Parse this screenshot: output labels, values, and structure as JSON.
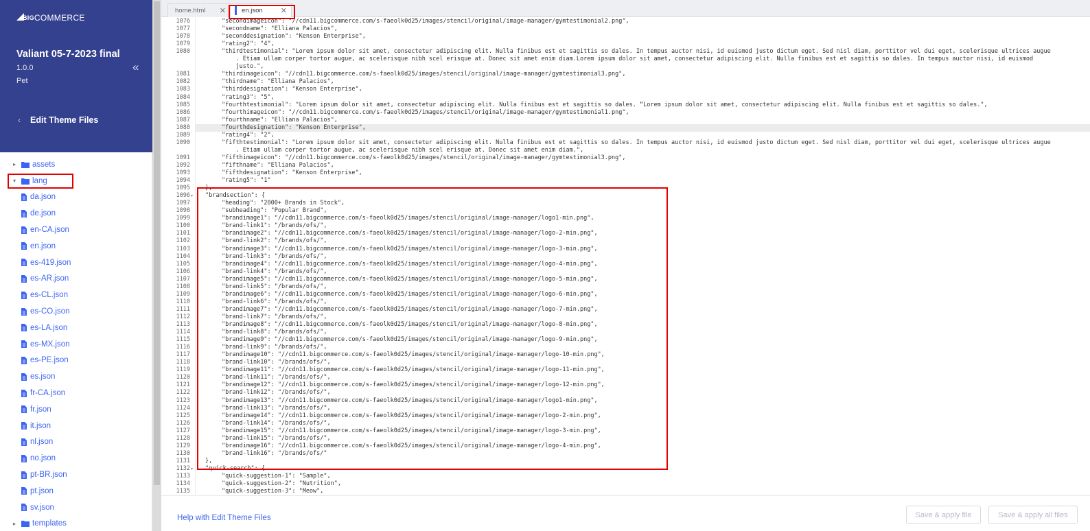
{
  "brand": {
    "logo_text": "COMMERCE",
    "logo_mark": "BIG"
  },
  "theme": {
    "name": "Valiant 05-7-2023 final",
    "version": "1.0.0",
    "category": "Pet"
  },
  "nav": {
    "back_label": "Edit Theme Files",
    "collapse_icon": "double-chevron-left-icon"
  },
  "tree": {
    "folders": [
      {
        "label": "assets",
        "expanded": false
      },
      {
        "label": "lang",
        "expanded": true
      },
      {
        "label": "templates",
        "expanded": false
      }
    ],
    "lang_files": [
      "da.json",
      "de.json",
      "en-CA.json",
      "en.json",
      "es-419.json",
      "es-AR.json",
      "es-CL.json",
      "es-CO.json",
      "es-LA.json",
      "es-MX.json",
      "es-PE.json",
      "es.json",
      "fr-CA.json",
      "fr.json",
      "it.json",
      "nl.json",
      "no.json",
      "pt-BR.json",
      "pt.json",
      "sv.json"
    ]
  },
  "tabs": [
    {
      "label": "home.html",
      "active": false
    },
    {
      "label": "en.json",
      "active": true
    }
  ],
  "editor": {
    "highlighted_line": 1088,
    "lines": [
      {
        "n": 1076,
        "t": "\"secondimageicon\": \"//cdn11.bigcommerce.com/s-faeolk0d25/images/stencil/original/image-manager/gymtestimonial2.png\",",
        "i": 2
      },
      {
        "n": 1077,
        "t": "\"secondname\": \"Elliana Palacios\",",
        "i": 2
      },
      {
        "n": 1078,
        "t": "\"seconddesignation\": \"Kenson Enterprise\",",
        "i": 2
      },
      {
        "n": 1079,
        "t": "\"rating2\": \"4\",",
        "i": 2
      },
      {
        "n": 1080,
        "t": "\"thirdtestimonial\": \"Lorem ipsum dolor sit amet, consectetur adipiscing elit. Nulla finibus est et sagittis so dales. In tempus auctor nisi, id euismod justo dictum eget. Sed nisl diam, porttitor vel dui eget, scelerisque ultrices augue",
        "i": 2
      },
      {
        "n": null,
        "t": "    . Etiam ullam corper tortor augue, ac scelerisque nibh scel erisque at. Donec sit amet enim diam.Lorem ipsum dolor sit amet, consectetur adipiscing elit. Nulla finibus est et sagittis so dales. In tempus auctor nisi, id euismod",
        "i": 2
      },
      {
        "n": null,
        "t": "    justo.\",",
        "i": 2
      },
      {
        "n": 1081,
        "t": "\"thirdimageicon\": \"//cdn11.bigcommerce.com/s-faeolk0d25/images/stencil/original/image-manager/gymtestimonial3.png\",",
        "i": 2
      },
      {
        "n": 1082,
        "t": "\"thirdname\": \"Elliana Palacios\",",
        "i": 2
      },
      {
        "n": 1083,
        "t": "\"thirddesignation\": \"Kenson Enterprise\",",
        "i": 2
      },
      {
        "n": 1084,
        "t": "\"rating3\": \"5\",",
        "i": 2
      },
      {
        "n": 1085,
        "t": "\"fourthtestimonial\": \"Lorem ipsum dolor sit amet, consectetur adipiscing elit. Nulla finibus est et sagittis so dales. “Lorem ipsum dolor sit amet, consectetur adipiscing elit. Nulla finibus est et sagittis so dales.\",",
        "i": 2
      },
      {
        "n": 1086,
        "t": "\"fourthimageicon\": \"//cdn11.bigcommerce.com/s-faeolk0d25/images/stencil/original/image-manager/gymtestimonial1.png\",",
        "i": 2
      },
      {
        "n": 1087,
        "t": "\"fourthname\": \"Elliana Palacios\",",
        "i": 2
      },
      {
        "n": 1088,
        "t": "\"fourthdesignation\": \"Kenson Enterprise\",",
        "i": 2
      },
      {
        "n": 1089,
        "t": "\"rating4\": \"2\",",
        "i": 2
      },
      {
        "n": 1090,
        "t": "\"fifthtestimonial\": \"Lorem ipsum dolor sit amet, consectetur adipiscing elit. Nulla finibus est et sagittis so dales. In tempus auctor nisi, id euismod justo dictum eget. Sed nisl diam, porttitor vel dui eget, scelerisque ultrices augue",
        "i": 2
      },
      {
        "n": null,
        "t": "    . Etiam ullam corper tortor augue, ac scelerisque nibh scel erisque at. Donec sit amet enim diam.\",",
        "i": 2
      },
      {
        "n": 1091,
        "t": "\"fifthimageicon\": \"//cdn11.bigcommerce.com/s-faeolk0d25/images/stencil/original/image-manager/gymtestimonial3.png\",",
        "i": 2
      },
      {
        "n": 1092,
        "t": "\"fifthname\": \"Elliana Palacios\",",
        "i": 2
      },
      {
        "n": 1093,
        "t": "\"fifthdesignation\": \"Kenson Enterprise\",",
        "i": 2
      },
      {
        "n": 1094,
        "t": "\"rating5\": \"1\"",
        "i": 2
      },
      {
        "n": 1095,
        "t": "},",
        "i": 1
      },
      {
        "n": 1096,
        "t": "\"brandsection\": {",
        "i": 1,
        "fold": true
      },
      {
        "n": 1097,
        "t": "\"heading\": \"2000+ Brands in Stock\",",
        "i": 2
      },
      {
        "n": 1098,
        "t": "\"subheading\": \"Popular Brand\",",
        "i": 2
      },
      {
        "n": 1099,
        "t": "\"brandimage1\": \"//cdn11.bigcommerce.com/s-faeolk0d25/images/stencil/original/image-manager/logo1-min.png\",",
        "i": 2
      },
      {
        "n": 1100,
        "t": "\"brand-link1\": \"/brands/ofs/\",",
        "i": 2
      },
      {
        "n": 1101,
        "t": "\"brandimage2\": \"//cdn11.bigcommerce.com/s-faeolk0d25/images/stencil/original/image-manager/logo-2-min.png\",",
        "i": 2
      },
      {
        "n": 1102,
        "t": "\"brand-link2\": \"/brands/ofs/\",",
        "i": 2
      },
      {
        "n": 1103,
        "t": "\"brandimage3\": \"//cdn11.bigcommerce.com/s-faeolk0d25/images/stencil/original/image-manager/logo-3-min.png\",",
        "i": 2
      },
      {
        "n": 1104,
        "t": "\"brand-link3\": \"/brands/ofs/\",",
        "i": 2
      },
      {
        "n": 1105,
        "t": "\"brandimage4\": \"//cdn11.bigcommerce.com/s-faeolk0d25/images/stencil/original/image-manager/logo-4-min.png\",",
        "i": 2
      },
      {
        "n": 1106,
        "t": "\"brand-link4\": \"/brands/ofs/\",",
        "i": 2
      },
      {
        "n": 1107,
        "t": "\"brandimage5\": \"//cdn11.bigcommerce.com/s-faeolk0d25/images/stencil/original/image-manager/logo-5-min.png\",",
        "i": 2
      },
      {
        "n": 1108,
        "t": "\"brand-link5\": \"/brands/ofs/\",",
        "i": 2
      },
      {
        "n": 1109,
        "t": "\"brandimage6\": \"//cdn11.bigcommerce.com/s-faeolk0d25/images/stencil/original/image-manager/logo-6-min.png\",",
        "i": 2
      },
      {
        "n": 1110,
        "t": "\"brand-link6\": \"/brands/ofs/\",",
        "i": 2
      },
      {
        "n": 1111,
        "t": "\"brandimage7\": \"//cdn11.bigcommerce.com/s-faeolk0d25/images/stencil/original/image-manager/logo-7-min.png\",",
        "i": 2
      },
      {
        "n": 1112,
        "t": "\"brand-link7\": \"/brands/ofs/\",",
        "i": 2
      },
      {
        "n": 1113,
        "t": "\"brandimage8\": \"//cdn11.bigcommerce.com/s-faeolk0d25/images/stencil/original/image-manager/logo-8-min.png\",",
        "i": 2
      },
      {
        "n": 1114,
        "t": "\"brand-link8\": \"/brands/ofs/\",",
        "i": 2
      },
      {
        "n": 1115,
        "t": "\"brandimage9\": \"//cdn11.bigcommerce.com/s-faeolk0d25/images/stencil/original/image-manager/logo-9-min.png\",",
        "i": 2
      },
      {
        "n": 1116,
        "t": "\"brand-link9\": \"/brands/ofs/\",",
        "i": 2
      },
      {
        "n": 1117,
        "t": "\"brandimage10\": \"//cdn11.bigcommerce.com/s-faeolk0d25/images/stencil/original/image-manager/logo-10-min.png\",",
        "i": 2
      },
      {
        "n": 1118,
        "t": "\"brand-link10\": \"/brands/ofs/\",",
        "i": 2
      },
      {
        "n": 1119,
        "t": "\"brandimage11\": \"//cdn11.bigcommerce.com/s-faeolk0d25/images/stencil/original/image-manager/logo-11-min.png\",",
        "i": 2
      },
      {
        "n": 1120,
        "t": "\"brand-link11\": \"/brands/ofs/\",",
        "i": 2
      },
      {
        "n": 1121,
        "t": "\"brandimage12\": \"//cdn11.bigcommerce.com/s-faeolk0d25/images/stencil/original/image-manager/logo-12-min.png\",",
        "i": 2
      },
      {
        "n": 1122,
        "t": "\"brand-link12\": \"/brands/ofs/\",",
        "i": 2
      },
      {
        "n": 1123,
        "t": "\"brandimage13\": \"//cdn11.bigcommerce.com/s-faeolk0d25/images/stencil/original/image-manager/logo1-min.png\",",
        "i": 2
      },
      {
        "n": 1124,
        "t": "\"brand-link13\": \"/brands/ofs/\",",
        "i": 2
      },
      {
        "n": 1125,
        "t": "\"brandimage14\": \"//cdn11.bigcommerce.com/s-faeolk0d25/images/stencil/original/image-manager/logo-2-min.png\",",
        "i": 2
      },
      {
        "n": 1126,
        "t": "\"brand-link14\": \"/brands/ofs/\",",
        "i": 2
      },
      {
        "n": 1127,
        "t": "\"brandimage15\": \"//cdn11.bigcommerce.com/s-faeolk0d25/images/stencil/original/image-manager/logo-3-min.png\",",
        "i": 2
      },
      {
        "n": 1128,
        "t": "\"brand-link15\": \"/brands/ofs/\",",
        "i": 2
      },
      {
        "n": 1129,
        "t": "\"brandimage16\": \"//cdn11.bigcommerce.com/s-faeolk0d25/images/stencil/original/image-manager/logo-4-min.png\",",
        "i": 2
      },
      {
        "n": 1130,
        "t": "\"brand-link16\": \"/brands/ofs/\"",
        "i": 2
      },
      {
        "n": 1131,
        "t": "},",
        "i": 1
      },
      {
        "n": 1132,
        "t": "\"quick-search\": {",
        "i": 1,
        "fold": true
      },
      {
        "n": 1133,
        "t": "\"quick-suggestion-1\": \"Sample\",",
        "i": 2
      },
      {
        "n": 1134,
        "t": "\"quick-suggestion-2\": \"Nutrition\",",
        "i": 2
      },
      {
        "n": 1135,
        "t": "\"quick-suggestion-3\": \"Meow\",",
        "i": 2
      }
    ]
  },
  "footer": {
    "help_link": "Help with Edit Theme Files",
    "save_apply_label": "Save & apply file",
    "save_apply_all_label": "Save & apply all files"
  },
  "accent_color": "#3c64f4",
  "header_color": "#34418f",
  "annotation_color": "#e00000"
}
